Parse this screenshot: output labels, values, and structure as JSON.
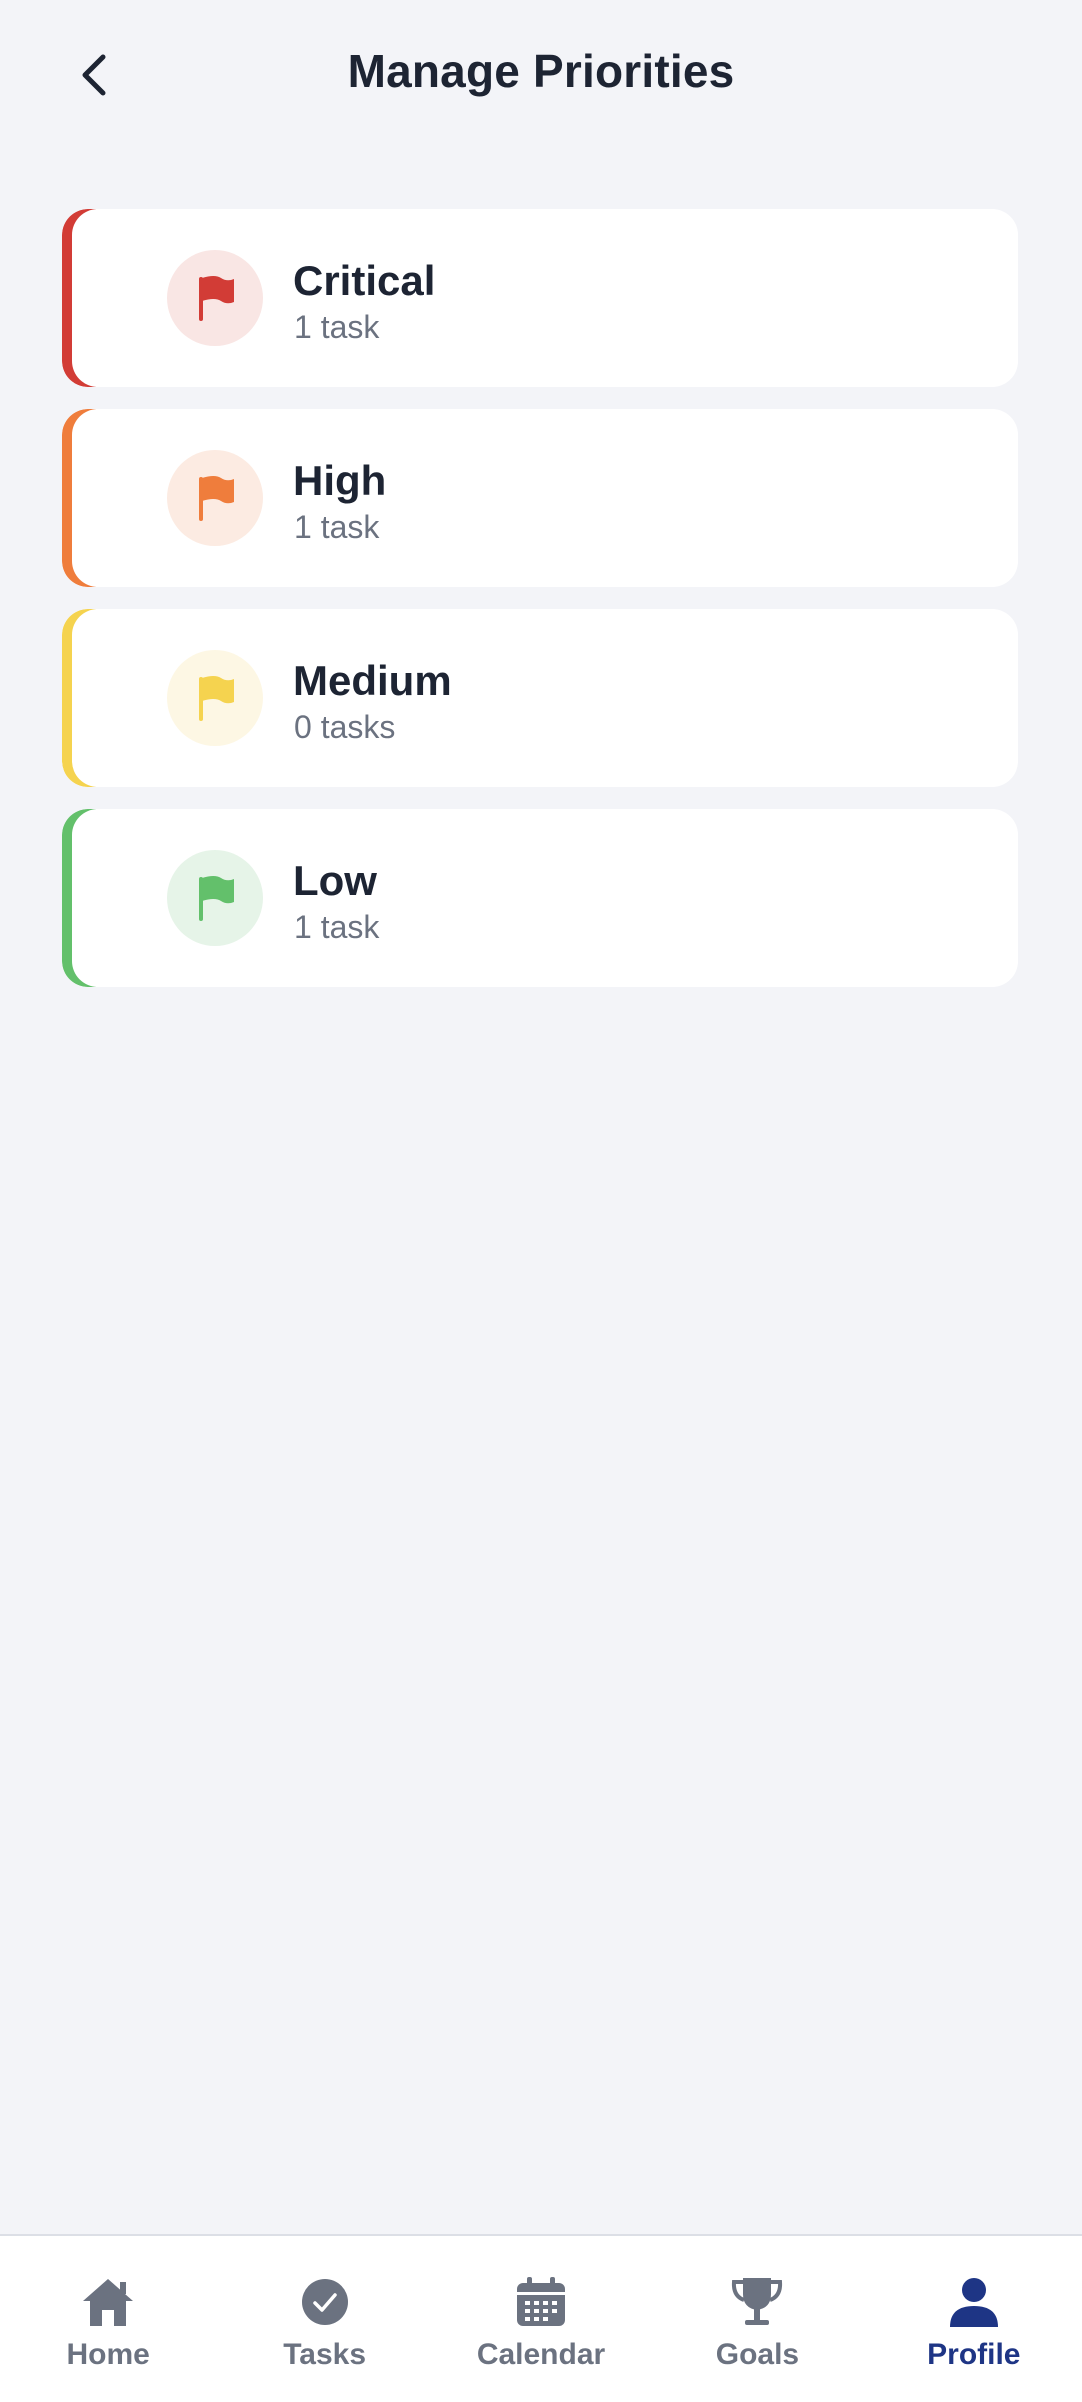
{
  "header": {
    "title": "Manage Priorities",
    "back_icon": "chevron-left-icon"
  },
  "priorities": [
    {
      "name": "Critical",
      "count": "1 task",
      "color": "#d23c36",
      "tint": "#f9e6e4",
      "icon": "flag-icon"
    },
    {
      "name": "High",
      "count": "1 task",
      "color": "#ef7d3c",
      "tint": "#fcebe2",
      "icon": "flag-icon"
    },
    {
      "name": "Medium",
      "count": "0 tasks",
      "color": "#f5d34f",
      "tint": "#fdf7e4",
      "icon": "flag-icon"
    },
    {
      "name": "Low",
      "count": "1 task",
      "color": "#63c06b",
      "tint": "#e6f4e8",
      "icon": "flag-icon"
    }
  ],
  "nav": {
    "items": [
      {
        "label": "Home",
        "icon": "home-icon",
        "active": false
      },
      {
        "label": "Tasks",
        "icon": "check-circle-icon",
        "active": false
      },
      {
        "label": "Calendar",
        "icon": "calendar-icon",
        "active": false
      },
      {
        "label": "Goals",
        "icon": "trophy-icon",
        "active": false
      },
      {
        "label": "Profile",
        "icon": "person-icon",
        "active": true
      }
    ],
    "inactive_color": "#6b7280",
    "active_color": "#1e3585"
  }
}
